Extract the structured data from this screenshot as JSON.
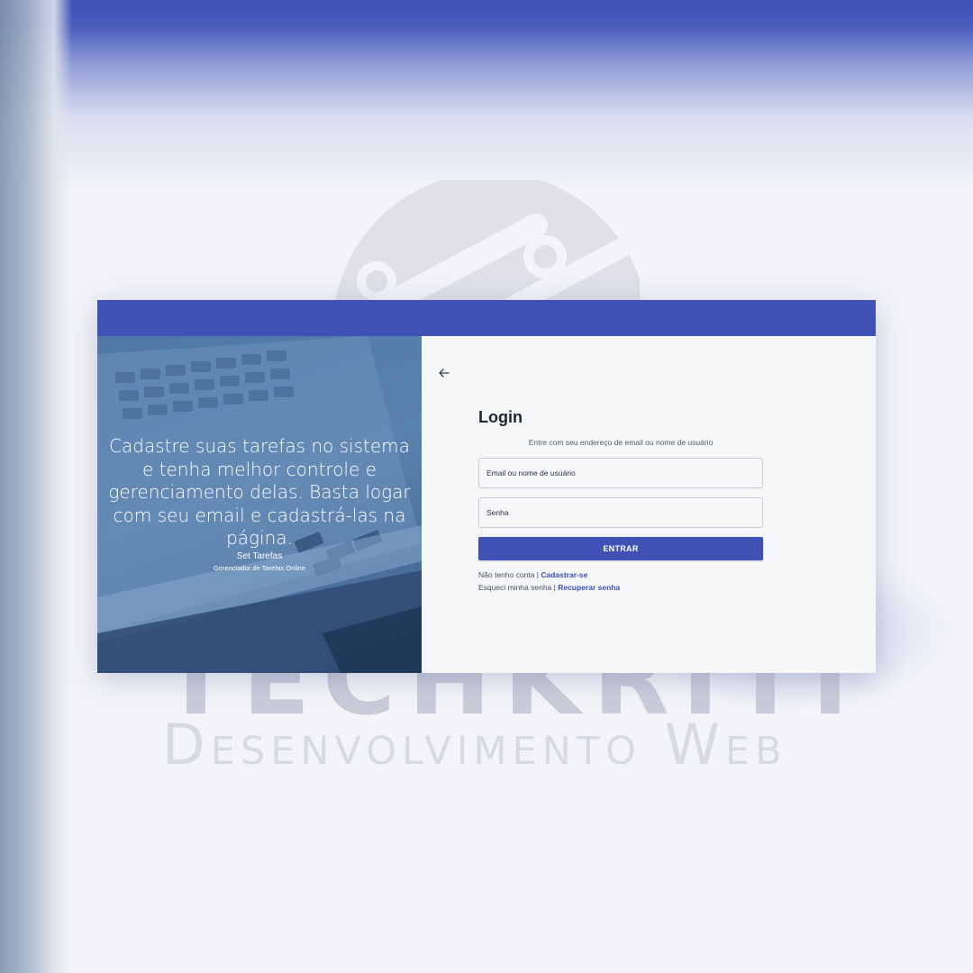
{
  "hero": {
    "text": "Cadastre suas tarefas no sistema e tenha melhor controle e gerenciamento delas. Basta logar com seu email e cadastrá-las na página.",
    "app_name": "Set Tarefas",
    "app_subtitle": "Gerenciador de Tarefas Online"
  },
  "login": {
    "title": "Login",
    "subtitle": "Entre com seu endereço de email ou nome de usuário",
    "email_placeholder": "Email ou nome de usuário",
    "password_placeholder": "Senha",
    "submit_label": "ENTRAR",
    "signup_prefix": "Não tenho conta |",
    "signup_link": "Cadastrar-se",
    "recover_prefix": "Esqueci minha senha |",
    "recover_link": "Recuperar senha"
  },
  "watermark": {
    "brand": "TECHKRITI",
    "tagline": "Desenvolvimento Web"
  },
  "icons": {
    "back": "arrow-left-icon"
  },
  "colors": {
    "primary": "#3f51b5",
    "background": "#f4f6f8",
    "hero_overlay": "#4f77a5"
  }
}
